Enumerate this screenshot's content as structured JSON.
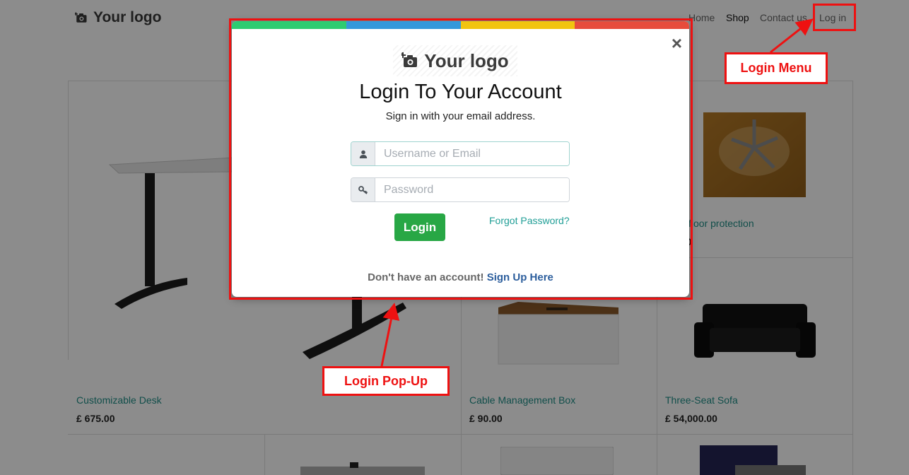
{
  "navbar": {
    "brand": "Your logo",
    "links": [
      "Home",
      "Shop",
      "Contact us",
      "Log in"
    ]
  },
  "products": [
    {
      "name": "Customizable Desk",
      "price": "£ 675.00"
    },
    {
      "name": "floor protection",
      "price": "30"
    },
    {
      "name": "Cable Management Box",
      "price": "£ 90.00"
    },
    {
      "name": "Three-Seat Sofa",
      "price": "£ 54,000.00"
    }
  ],
  "modal": {
    "logo": "Your logo",
    "title": "Login To Your Account",
    "subtitle": "Sign in with your email address.",
    "username_placeholder": "Username or Email",
    "password_placeholder": "Password",
    "login_label": "Login",
    "forgot_label": "Forgot Password?",
    "signup_prompt": "Don't have an account!",
    "signup_link": "Sign Up Here",
    "close_symbol": "×",
    "strip_colors": [
      "#2ecc71",
      "#3498db",
      "#f1c40f",
      "#e74c3c"
    ]
  },
  "annotations": {
    "login_menu": "Login Menu",
    "login_popup": "Login Pop-Up",
    "color": "#ee1111"
  },
  "icons": {
    "brand": "camera-plus-icon",
    "username": "user-icon",
    "password": "key-icon",
    "close": "close-icon"
  }
}
